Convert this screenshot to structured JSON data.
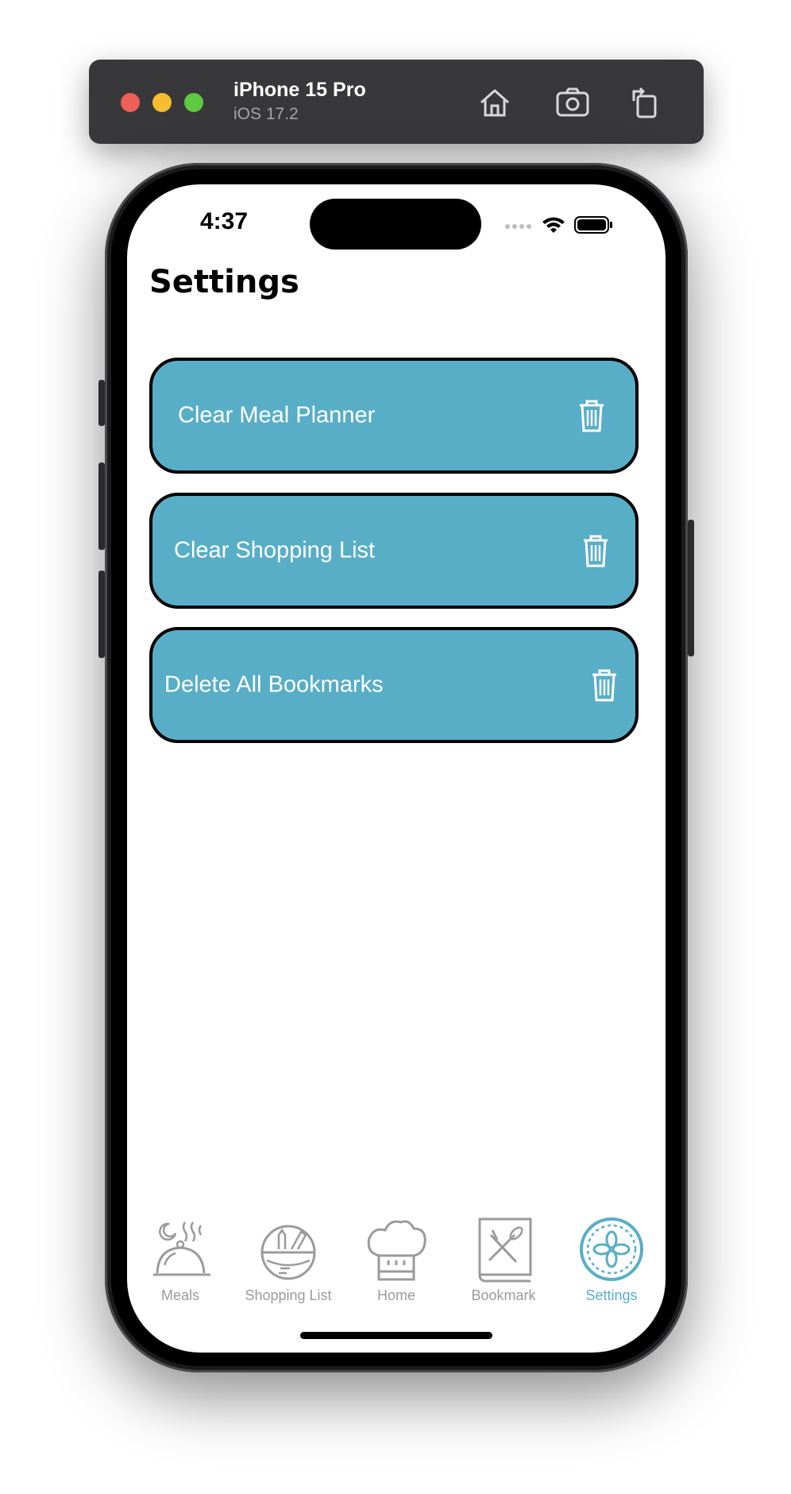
{
  "simulator": {
    "device": "iPhone 15 Pro",
    "os": "iOS 17.2",
    "icons": [
      "home-icon",
      "screenshot-icon",
      "rotate-icon"
    ]
  },
  "status_bar": {
    "time": "4:37",
    "icons": [
      "signal-icon",
      "wifi-icon",
      "battery-icon"
    ]
  },
  "page": {
    "title": "Settings"
  },
  "actions": [
    {
      "label": "Clear Meal Planner",
      "icon": "trash-icon"
    },
    {
      "label": "Clear Shopping List",
      "icon": "trash-icon"
    },
    {
      "label": "Delete All Bookmarks",
      "icon": "trash-icon"
    }
  ],
  "tabbar": {
    "items": [
      {
        "label": "Meals",
        "icon": "meal-cloche-icon",
        "active": false
      },
      {
        "label": "Shopping List",
        "icon": "basket-icon",
        "active": false
      },
      {
        "label": "Home",
        "icon": "chef-hat-icon",
        "active": false
      },
      {
        "label": "Bookmark",
        "icon": "recipe-book-icon",
        "active": false
      },
      {
        "label": "Settings",
        "icon": "settings-icon",
        "active": true
      }
    ]
  },
  "colors": {
    "accent": "#58aec7",
    "tab_inactive": "#9b9b9b",
    "button_border": "#000000"
  }
}
